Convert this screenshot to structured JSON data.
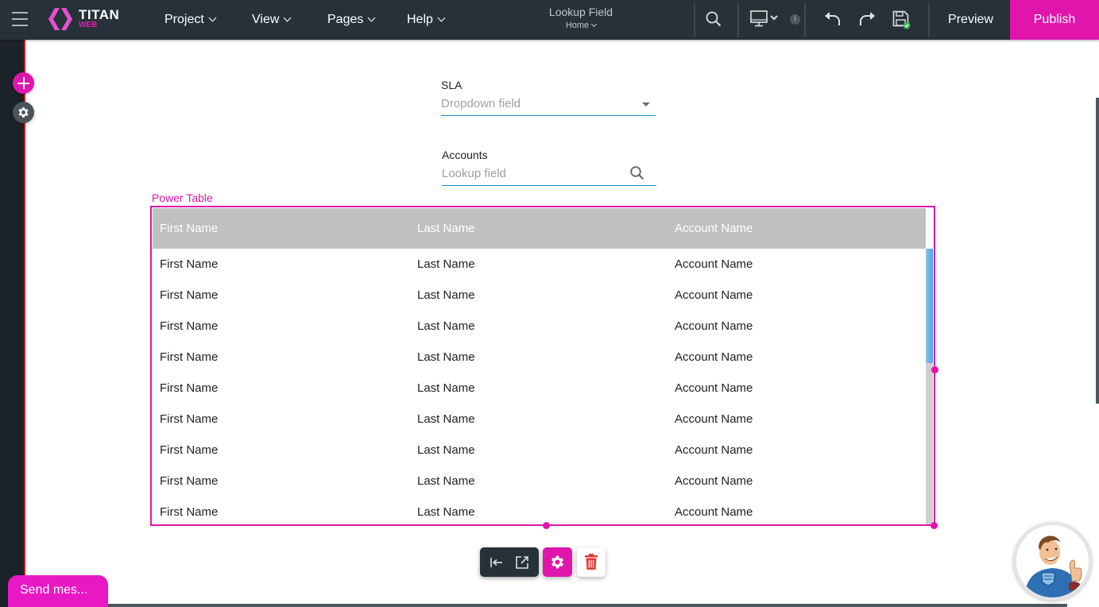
{
  "topbar": {
    "brand_name": "TITAN",
    "brand_sub": "WEB",
    "menus": [
      {
        "label": "Project"
      },
      {
        "label": "View"
      },
      {
        "label": "Pages"
      },
      {
        "label": "Help"
      }
    ],
    "doc_title": "Lookup Field",
    "doc_page": "Home",
    "info_badge": "i",
    "preview_label": "Preview",
    "publish_label": "Publish",
    "icons": [
      "menu-icon",
      "search-icon",
      "desktop-icon",
      "info-icon",
      "undo-icon",
      "redo-icon",
      "save-icon"
    ]
  },
  "left_rail": {
    "add_icon": "plus-icon",
    "settings_icon": "gear-icon"
  },
  "form": {
    "sla": {
      "label": "SLA",
      "placeholder": "Dropdown field"
    },
    "accounts": {
      "label": "Accounts",
      "placeholder": "Lookup field"
    }
  },
  "power_table": {
    "label": "Power Table",
    "columns": [
      "First Name",
      "Last Name",
      "Account Name"
    ],
    "rows": [
      [
        "First Name",
        "Last Name",
        "Account Name"
      ],
      [
        "First Name",
        "Last Name",
        "Account Name"
      ],
      [
        "First Name",
        "Last Name",
        "Account Name"
      ],
      [
        "First Name",
        "Last Name",
        "Account Name"
      ],
      [
        "First Name",
        "Last Name",
        "Account Name"
      ],
      [
        "First Name",
        "Last Name",
        "Account Name"
      ],
      [
        "First Name",
        "Last Name",
        "Account Name"
      ],
      [
        "First Name",
        "Last Name",
        "Account Name"
      ],
      [
        "First Name",
        "Last Name",
        "Account Name"
      ]
    ]
  },
  "element_toolbar": {
    "icons": [
      "align-left-icon",
      "open-external-icon",
      "gear-icon",
      "trash-icon"
    ]
  },
  "chat": {
    "label": "Send mes..."
  },
  "colors": {
    "brand_pink": "#e015ac",
    "topbar_bg": "#263238",
    "field_underline": "#1a8ad6",
    "table_header_bg": "#bfc0bf",
    "delete_red": "#e53935"
  }
}
